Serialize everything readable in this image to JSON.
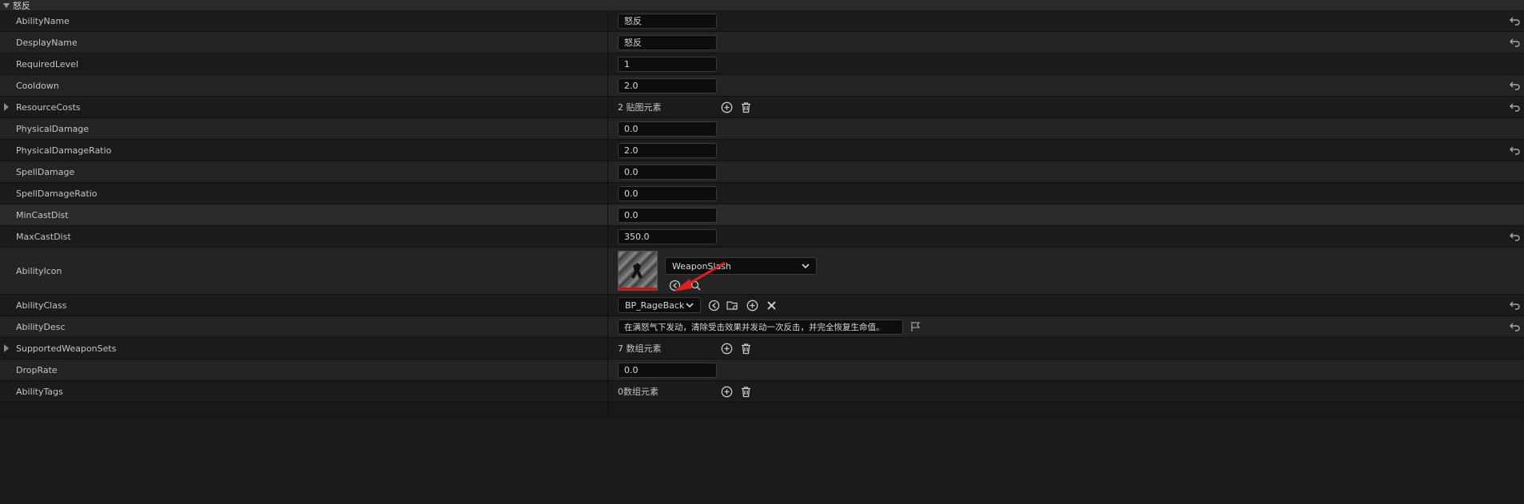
{
  "section": {
    "title": "怒反"
  },
  "rows": {
    "ability_name": {
      "label": "AbilityName",
      "value": "怒反"
    },
    "display_name": {
      "label": "DesplayName",
      "value": "怒反"
    },
    "required_level": {
      "label": "RequiredLevel",
      "value": "1"
    },
    "cooldown": {
      "label": "Cooldown",
      "value": "2.0"
    },
    "resource_costs": {
      "label": "ResourceCosts",
      "value": "2 贴图元素"
    },
    "physical_damage": {
      "label": "PhysicalDamage",
      "value": "0.0"
    },
    "physical_damage_ratio": {
      "label": "PhysicalDamageRatio",
      "value": "2.0"
    },
    "spell_damage": {
      "label": "SpellDamage",
      "value": "0.0"
    },
    "spell_damage_ratio": {
      "label": "SpellDamageRatio",
      "value": "0.0"
    },
    "min_cast_dist": {
      "label": "MinCastDist",
      "value": "0.0"
    },
    "max_cast_dist": {
      "label": "MaxCastDist",
      "value": "350.0"
    },
    "ability_icon": {
      "label": "AbilityIcon",
      "value": "WeaponSlash"
    },
    "ability_class": {
      "label": "AbilityClass",
      "value": "BP_RageBack"
    },
    "ability_desc": {
      "label": "AbilityDesc",
      "value": "在满怒气下发动，清除受击效果并发动一次反击，并完全恢复生命值。"
    },
    "supported_weapon_sets": {
      "label": "SupportedWeaponSets",
      "value": "7 数组元素"
    },
    "drop_rate": {
      "label": "DropRate",
      "value": "0.0"
    },
    "ability_tags": {
      "label": "AbilityTags",
      "value": "0数组元素"
    }
  },
  "icons": {
    "reset": "reset-arrow-icon",
    "add": "add-element-icon",
    "delete": "trash-icon",
    "browse": "browse-to-asset-icon",
    "use_selected": "use-selected-icon",
    "clear": "clear-x-icon",
    "expander": "expander-triangle-icon",
    "dropdown": "chevron-down-icon",
    "localize": "localization-flag-icon",
    "annotation": "red-arrow-annotation"
  },
  "colors": {
    "background": "#1b1b1b",
    "row_alt": "#242424",
    "field_bg": "#0d0d0d",
    "annotation_arrow": "#e02020"
  }
}
